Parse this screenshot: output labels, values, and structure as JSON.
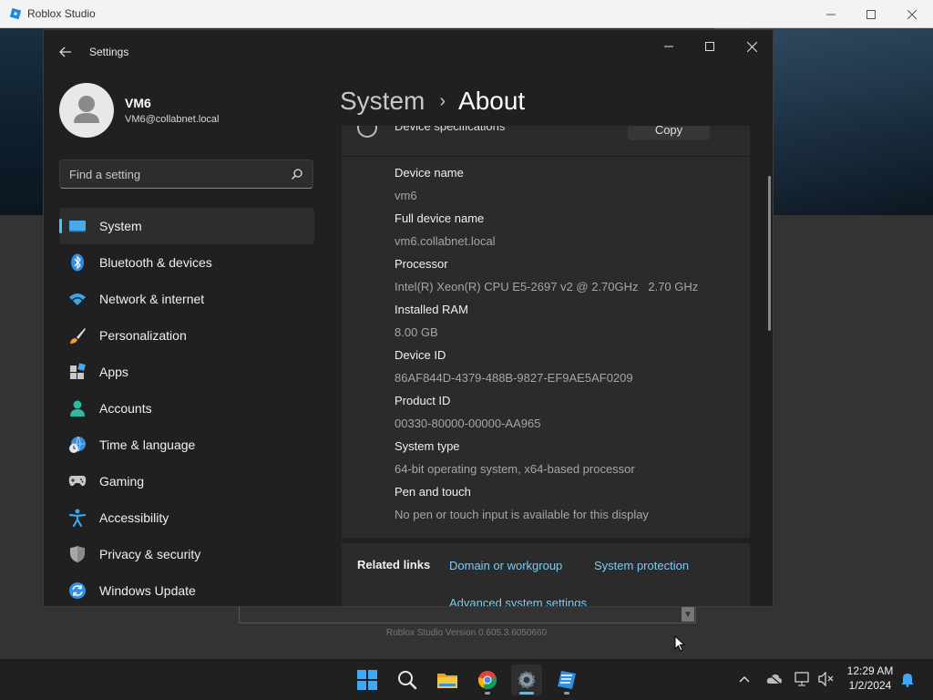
{
  "roblox": {
    "window_title": "Roblox Studio",
    "version_text": "Roblox Studio Version 0.605.3.6050660"
  },
  "settings": {
    "app_title": "Settings",
    "profile": {
      "name": "VM6",
      "email": "VM6@collabnet.local"
    },
    "search": {
      "placeholder": "Find a setting"
    },
    "nav": [
      {
        "label": "System",
        "icon": "system-icon"
      },
      {
        "label": "Bluetooth & devices",
        "icon": "bluetooth-icon"
      },
      {
        "label": "Network & internet",
        "icon": "network-icon"
      },
      {
        "label": "Personalization",
        "icon": "brush-icon"
      },
      {
        "label": "Apps",
        "icon": "apps-icon"
      },
      {
        "label": "Accounts",
        "icon": "accounts-icon"
      },
      {
        "label": "Time & language",
        "icon": "globe-clock-icon"
      },
      {
        "label": "Gaming",
        "icon": "gamepad-icon"
      },
      {
        "label": "Accessibility",
        "icon": "accessibility-icon"
      },
      {
        "label": "Privacy & security",
        "icon": "shield-icon"
      },
      {
        "label": "Windows Update",
        "icon": "update-icon"
      }
    ],
    "breadcrumb": {
      "parent": "System",
      "current": "About"
    },
    "device_specs": {
      "title": "Device specifications",
      "copy_label": "Copy",
      "rows": [
        {
          "label": "Device name",
          "value": "vm6"
        },
        {
          "label": "Full device name",
          "value": "vm6.collabnet.local"
        },
        {
          "label": "Processor",
          "value": "Intel(R) Xeon(R) CPU E5-2697 v2 @ 2.70GHz   2.70 GHz"
        },
        {
          "label": "Installed RAM",
          "value": "8.00 GB"
        },
        {
          "label": "Device ID",
          "value": "86AF844D-4379-488B-9827-EF9AE5AF0209"
        },
        {
          "label": "Product ID",
          "value": "00330-80000-00000-AA965"
        },
        {
          "label": "System type",
          "value": "64-bit operating system, x64-based processor"
        },
        {
          "label": "Pen and touch",
          "value": "No pen or touch input is available for this display"
        }
      ]
    },
    "related_links": {
      "title": "Related links",
      "links": [
        "Domain or workgroup",
        "System protection",
        "Advanced system settings"
      ]
    }
  },
  "taskbar": {
    "time": "12:29 AM",
    "date": "1/2/2024"
  },
  "colors": {
    "accent": "#4cc2ff",
    "link": "#7fcbf0",
    "window_bg": "#202020",
    "card_bg": "#2b2b2b"
  }
}
